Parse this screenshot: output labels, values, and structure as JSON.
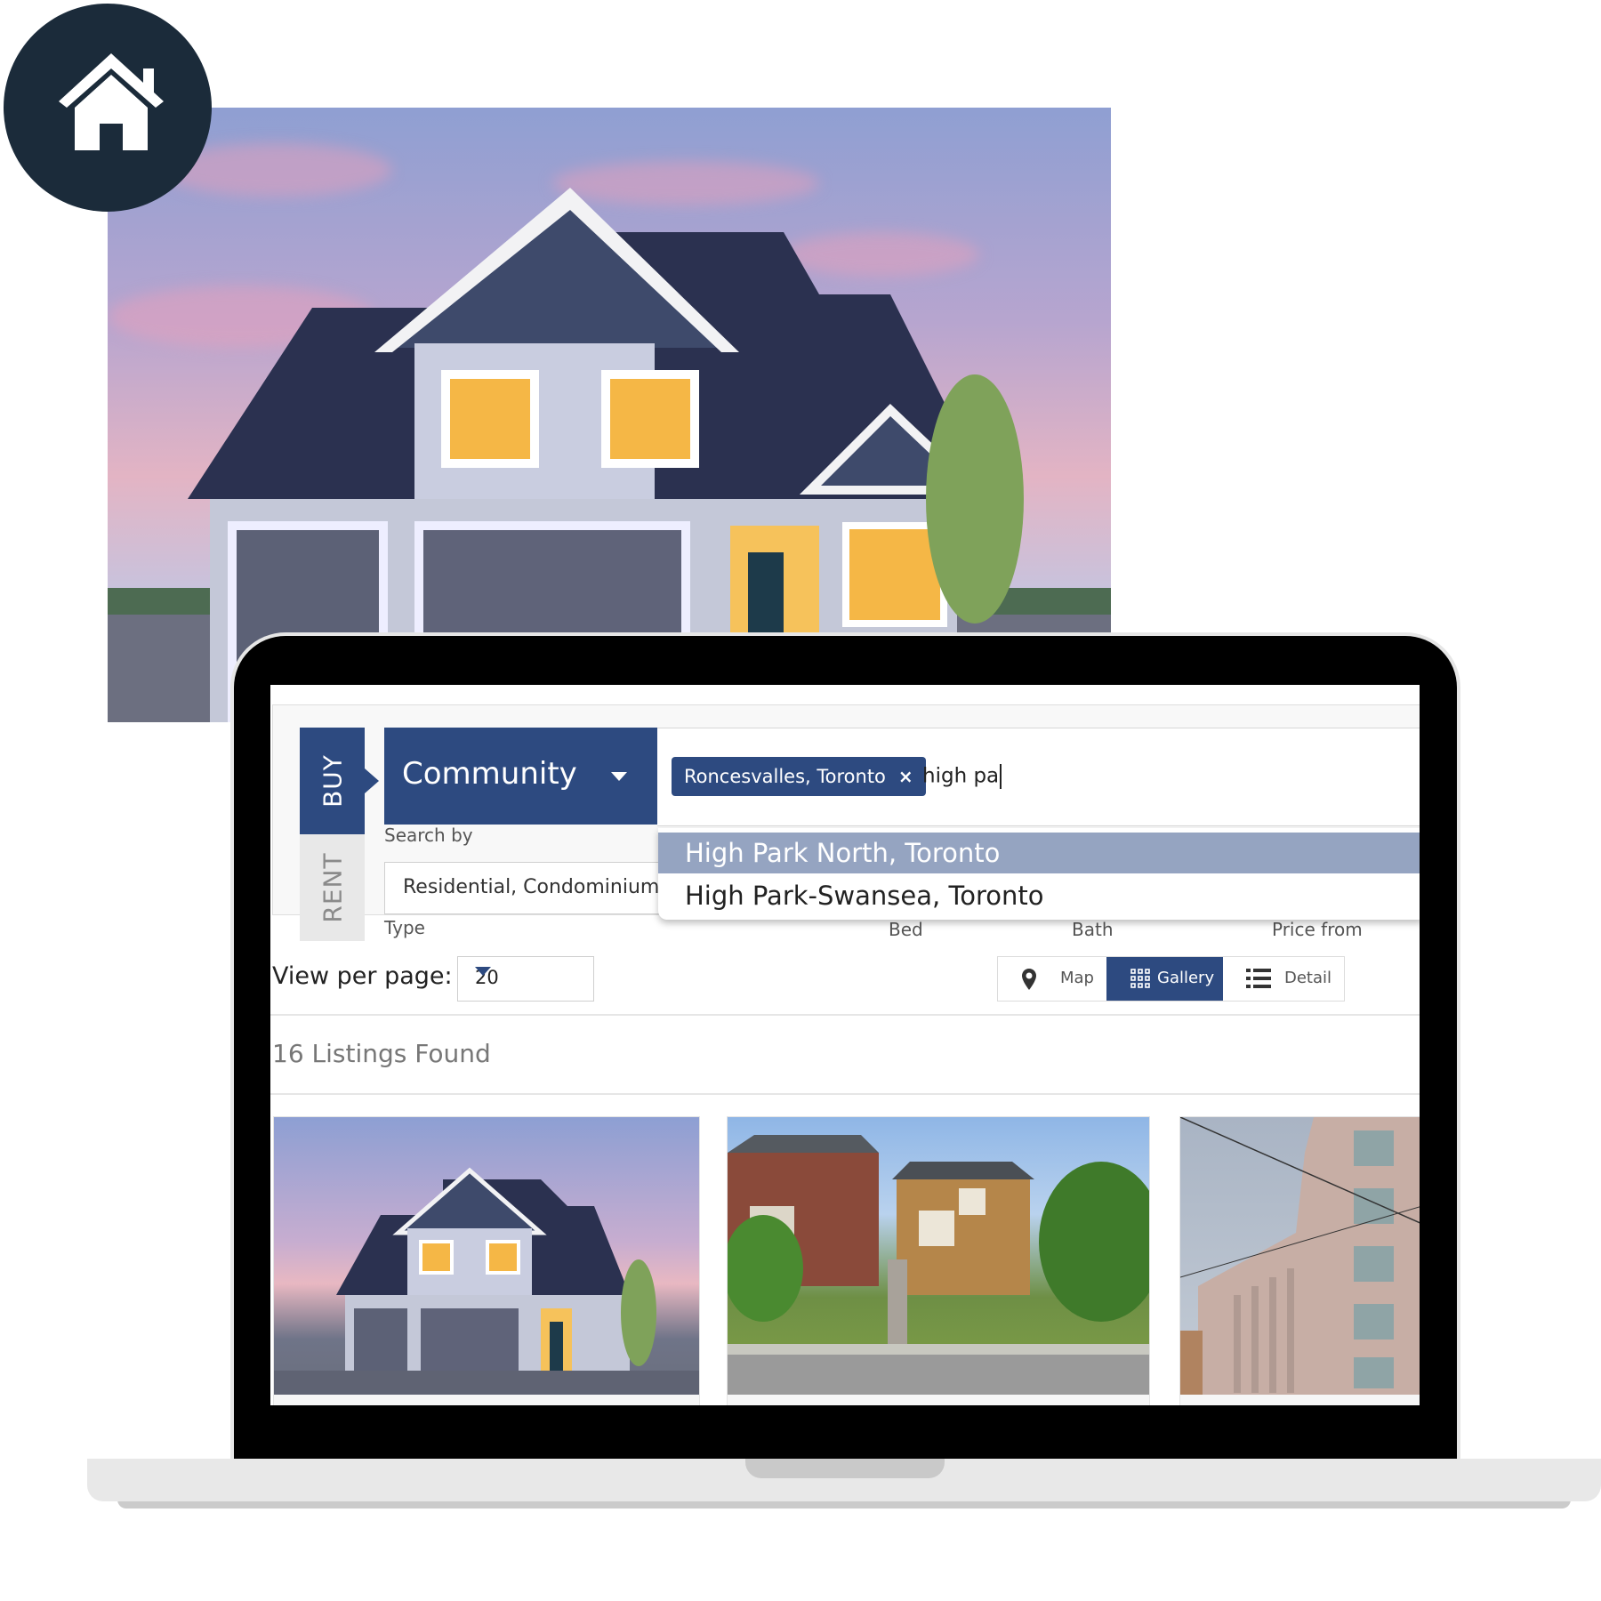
{
  "badge": {
    "icon": "home-icon"
  },
  "hero": {
    "description": "two-storey house with garages at dusk"
  },
  "search": {
    "tabs": [
      {
        "label": "BUY",
        "active": true
      },
      {
        "label": "RENT",
        "active": false
      }
    ],
    "search_by": {
      "value": "Community",
      "label": "Search by"
    },
    "type": {
      "value": "Residential, Condominium,",
      "label": "Type"
    },
    "chips": [
      {
        "label": "Roncesvalles, Toronto",
        "remove": "×"
      }
    ],
    "typed_text": "high pa",
    "suggestions": [
      {
        "label": "High Park North, Toronto",
        "highlighted": true
      },
      {
        "label": "High Park-Swansea, Toronto",
        "highlighted": false
      }
    ],
    "hidden_labels": {
      "bed": "Bed",
      "bath": "Bath",
      "price_from": "Price from"
    }
  },
  "toolbar": {
    "view_per_page_label": "View per page:",
    "view_per_page_value": "20",
    "views": [
      {
        "label": "Map",
        "icon": "map-pin-icon",
        "active": false
      },
      {
        "label": "Gallery",
        "icon": "grid-icon",
        "active": true
      },
      {
        "label": "Detail",
        "icon": "list-icon",
        "active": false
      }
    ]
  },
  "results": {
    "count_text": "16 Listings Found",
    "listings": [
      {
        "image": "suburban house at dusk"
      },
      {
        "image": "brick semi-detached homes with stairs"
      },
      {
        "image": "high-rise condominium building"
      }
    ]
  },
  "colors": {
    "primary": "#2d4a80",
    "highlight": "#95a4c1",
    "badge": "#1b2b3a"
  }
}
